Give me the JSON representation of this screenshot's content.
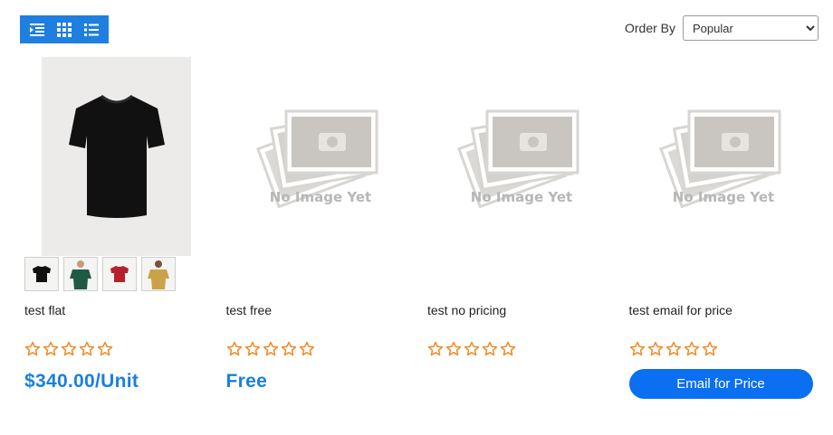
{
  "toolbar": {
    "view_buttons": [
      {
        "name": "indent-view-icon"
      },
      {
        "name": "grid-view-icon"
      },
      {
        "name": "list-view-icon"
      }
    ],
    "order_by_label": "Order By",
    "order_by_selected": "Popular"
  },
  "products": [
    {
      "title": "test flat",
      "rating": 0,
      "price": "$340.00/Unit",
      "has_image": true,
      "thumbnails": [
        "black-tshirt",
        "green-tshirt-model",
        "red-tshirt",
        "mustard-tshirt-model"
      ]
    },
    {
      "title": "test free",
      "rating": 0,
      "price": "Free",
      "has_image": false,
      "placeholder_text": "No Image Yet"
    },
    {
      "title": "test no pricing",
      "rating": 0,
      "has_image": false,
      "placeholder_text": "No Image Yet"
    },
    {
      "title": "test email for price",
      "rating": 0,
      "has_image": false,
      "placeholder_text": "No Image Yet",
      "button_label": "Email for Price"
    }
  ],
  "colors": {
    "accent": "#1e7fe0",
    "price": "#1a7fe0",
    "button": "#0a6ff0",
    "star": "#f08a24"
  }
}
